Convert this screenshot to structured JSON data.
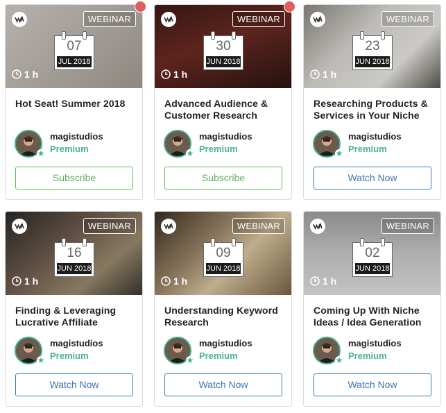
{
  "cards": [
    {
      "badge": "WEBINAR",
      "day": "07",
      "month": "JUL 2018",
      "duration": "1 h",
      "title": "Hot Seat! Summer 2018",
      "author": "magistudios",
      "tier": "Premium",
      "button": "Subscribe"
    },
    {
      "badge": "WEBINAR",
      "day": "30",
      "month": "JUN 2018",
      "duration": "1 h",
      "title": "Advanced Audience & Customer Research",
      "author": "magistudios",
      "tier": "Premium",
      "button": "Subscribe"
    },
    {
      "badge": "WEBINAR",
      "day": "23",
      "month": "JUN 2018",
      "duration": "1 h",
      "title": "Researching Products & Services in Your Niche",
      "author": "magistudios",
      "tier": "Premium",
      "button": "Watch Now"
    },
    {
      "badge": "WEBINAR",
      "day": "16",
      "month": "JUN 2018",
      "duration": "1 h",
      "title": "Finding & Leveraging Lucrative Affiliate",
      "author": "magistudios",
      "tier": "Premium",
      "button": "Watch Now"
    },
    {
      "badge": "WEBINAR",
      "day": "09",
      "month": "JUN 2018",
      "duration": "1 h",
      "title": "Understanding Keyword Research",
      "author": "magistudios",
      "tier": "Premium",
      "button": "Watch Now"
    },
    {
      "badge": "WEBINAR",
      "day": "02",
      "month": "JUN 2018",
      "duration": "1 h",
      "title": "Coming Up With Niche Ideas / Idea Generation",
      "author": "magistudios",
      "tier": "Premium",
      "button": "Watch Now"
    }
  ],
  "icons": {
    "logo": "wa-logo-icon",
    "clock": "clock-icon",
    "calendar": "calendar-icon",
    "star": "star-icon",
    "notification": "notification-dot"
  },
  "colors": {
    "subscribe": "#5cb85c",
    "watch": "#337ab7",
    "premium": "#4ab58a",
    "dot": "#e05d5d"
  }
}
